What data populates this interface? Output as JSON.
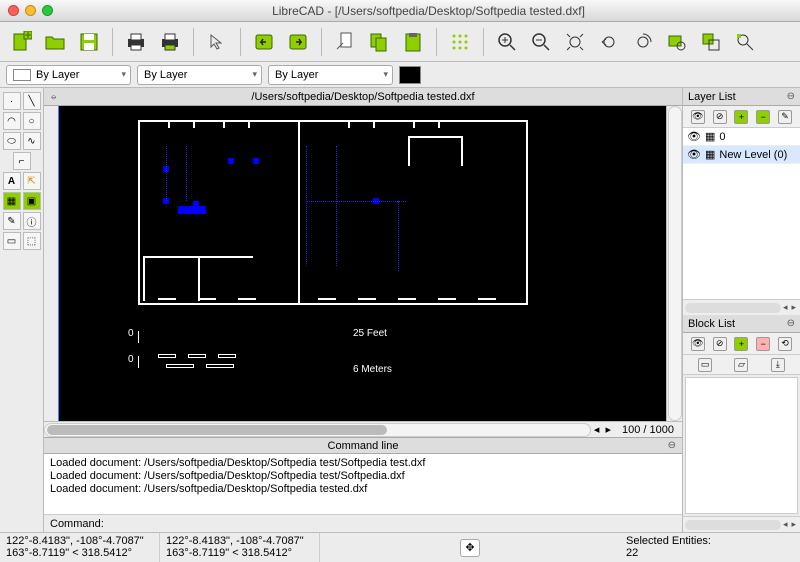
{
  "window": {
    "title": "LibreCAD - [/Users/softpedia/Desktop/Softpedia tested.dxf]",
    "doc_tab": "/Users/softpedia/Desktop/Softpedia tested.dxf"
  },
  "selectors": {
    "layer": "By Layer",
    "linetype": "By Layer",
    "lineweight": "By Layer"
  },
  "zoom": {
    "current": "100",
    "max": "1000"
  },
  "canvas_labels": {
    "feet_zero_l": "0",
    "feet_zero_r": "0",
    "feet": "25 Feet",
    "meters": "6 Meters"
  },
  "layer_panel": {
    "title": "Layer List",
    "rows": [
      {
        "name": "0"
      },
      {
        "name": "New Level (0)"
      }
    ]
  },
  "block_panel": {
    "title": "Block List"
  },
  "command": {
    "title": "Command line",
    "lines": [
      "Loaded document: /Users/softpedia/Desktop/Softpedia test/Softpedia test.dxf",
      "Loaded document: /Users/softpedia/Desktop/Softpedia test/Softpedia.dxf",
      "Loaded document: /Users/softpedia/Desktop/Softpedia tested.dxf"
    ],
    "prompt": "Command:"
  },
  "status": {
    "coord1a": "122°-8.4183\", -108°-4.7087\"",
    "coord1b": "163°-8.7119\" < 318.5412°",
    "coord2a": "122°-8.4183\", -108°-4.7087\"",
    "coord2b": "163°-8.7119\" < 318.5412°",
    "sel_label": "Selected Entities:",
    "sel_count": "22"
  }
}
